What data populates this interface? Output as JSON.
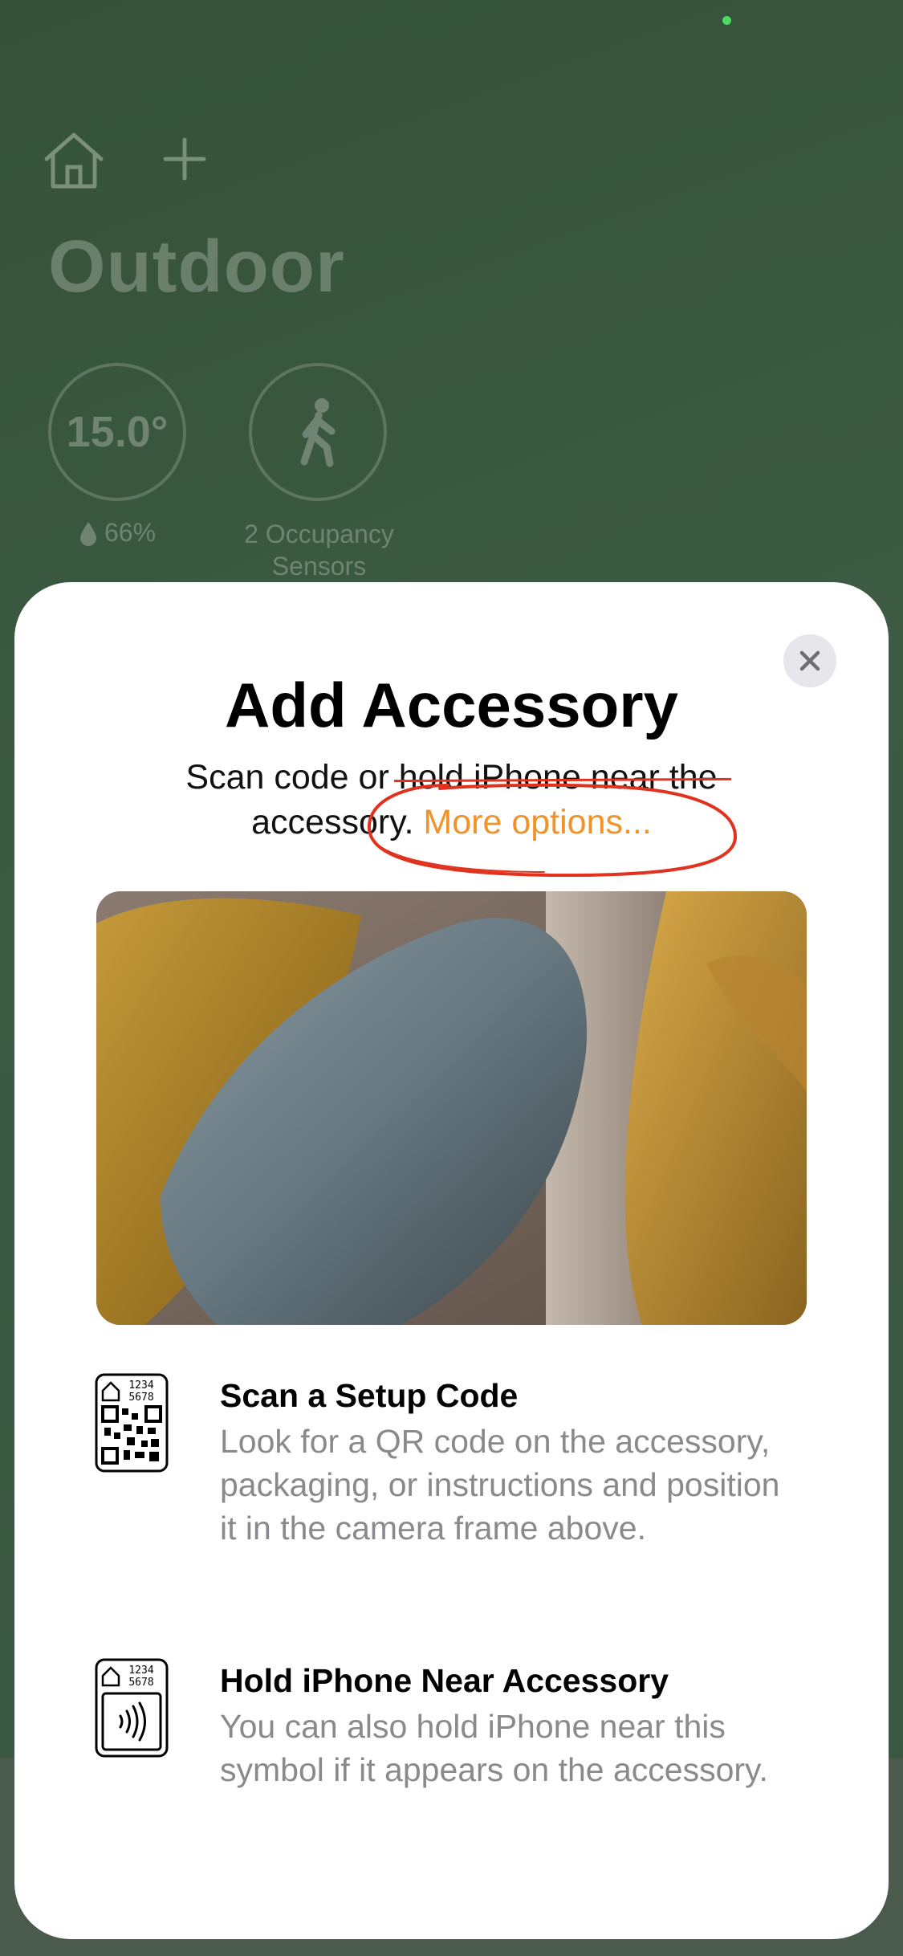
{
  "header": {
    "room_title": "Outdoor",
    "home_icon": "house-icon",
    "add_icon": "plus-icon"
  },
  "tiles": {
    "temperature": "15.0°",
    "humidity": "66%",
    "occupancy_label": "2 Occupancy Sensors"
  },
  "sheet": {
    "title": "Add Accessory",
    "subtitle": "Scan code or hold iPhone near the accessory.",
    "more_options": "More options...",
    "close_icon": "xmark-icon",
    "rows": [
      {
        "icon": "qr-code-icon",
        "icon_number_1": "1234",
        "icon_number_2": "5678",
        "title": "Scan a Setup Code",
        "description": "Look for a QR code on the accessory, packaging, or instructions and position it in the camera frame above."
      },
      {
        "icon": "nfc-tag-icon",
        "icon_number_1": "1234",
        "icon_number_2": "5678",
        "title": "Hold iPhone Near Accessory",
        "description": "You can also hold iPhone near this symbol if it appears on the accessory."
      }
    ]
  },
  "colors": {
    "accent": "#f0932b",
    "annotation_red": "#e0321f",
    "backdrop": "#3d5a43"
  }
}
